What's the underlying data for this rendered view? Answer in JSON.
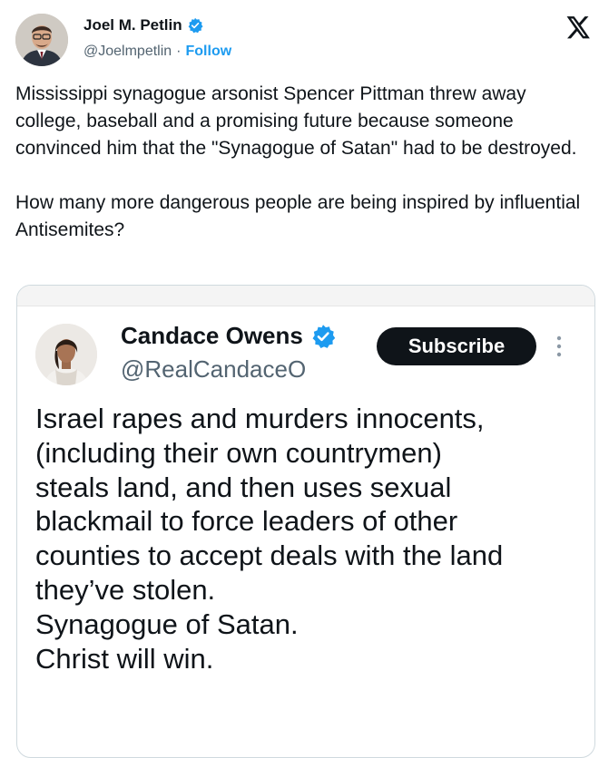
{
  "author": {
    "name": "Joel M. Petlin",
    "handle": "@Joelmpetlin",
    "separator": "·",
    "follow_label": "Follow"
  },
  "tweet_paragraphs": [
    "Mississippi synagogue arsonist Spencer Pittman threw away college, baseball and a promising future because someone convinced him that the \"Synagogue of Satan\" had to be destroyed.",
    "How many more dangerous people are being inspired by influential Antisemites?"
  ],
  "quoted": {
    "name": "Candace Owens",
    "handle": "@RealCandaceO",
    "subscribe_label": "Subscribe",
    "text": "Israel rapes and murders innocents,\n(including their own countrymen)\nsteals land, and then uses sexual\nblackmail to force leaders of other\ncounties to accept deals with the land\nthey’ve stolen.\nSynagogue of Satan.\nChrist will win."
  },
  "icons": {
    "brand": "x-logo-icon",
    "verified": "verified-badge-icon",
    "more": "more-vertical-icon"
  },
  "colors": {
    "text": "#0f1419",
    "secondary": "#536471",
    "accent": "#1d9bf0",
    "button": "#0f1419",
    "border": "#cfd9de"
  }
}
